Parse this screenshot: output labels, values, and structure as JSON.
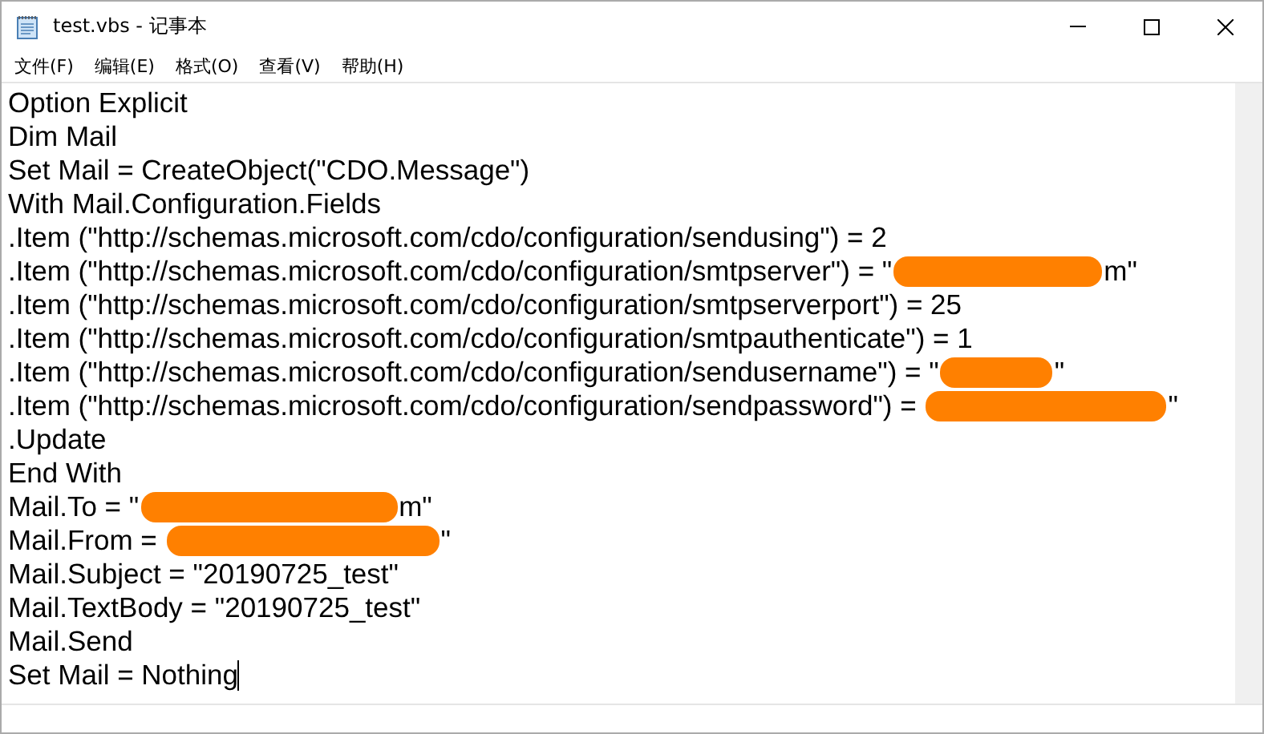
{
  "window": {
    "title": "test.vbs - 记事本"
  },
  "menu": [
    "文件(F)",
    "编辑(E)",
    "格式(O)",
    "查看(V)",
    "帮助(H)"
  ],
  "editor": {
    "lines": [
      {
        "caret": false,
        "parts": [
          {
            "kind": "text",
            "text": "Option Explicit"
          }
        ]
      },
      {
        "caret": false,
        "parts": [
          {
            "kind": "text",
            "text": "Dim Mail"
          }
        ]
      },
      {
        "caret": false,
        "parts": [
          {
            "kind": "text",
            "text": "Set Mail = CreateObject(\"CDO.Message\")"
          }
        ]
      },
      {
        "caret": false,
        "parts": [
          {
            "kind": "text",
            "text": "With Mail.Configuration.Fields"
          }
        ]
      },
      {
        "caret": false,
        "parts": [
          {
            "kind": "text",
            "text": ".Item (\"http://schemas.microsoft.com/cdo/configuration/sendusing\") = 2"
          }
        ]
      },
      {
        "caret": false,
        "parts": [
          {
            "kind": "text",
            "text": ".Item (\"http://schemas.microsoft.com/cdo/configuration/smtpserver\") = \""
          },
          {
            "kind": "redaction"
          },
          {
            "kind": "text",
            "text": "m\""
          }
        ]
      },
      {
        "caret": false,
        "parts": [
          {
            "kind": "text",
            "text": ".Item (\"http://schemas.microsoft.com/cdo/configuration/smtpserverport\") = 25"
          }
        ]
      },
      {
        "caret": false,
        "parts": [
          {
            "kind": "text",
            "text": ".Item (\"http://schemas.microsoft.com/cdo/configuration/smtpauthenticate\") = 1"
          }
        ]
      },
      {
        "caret": false,
        "parts": [
          {
            "kind": "text",
            "text": ".Item (\"http://schemas.microsoft.com/cdo/configuration/sendusername\") = \""
          },
          {
            "kind": "redaction"
          },
          {
            "kind": "text",
            "text": "\""
          }
        ]
      },
      {
        "caret": false,
        "parts": [
          {
            "kind": "text",
            "text": ".Item (\"http://schemas.microsoft.com/cdo/configuration/sendpassword\") = "
          },
          {
            "kind": "redaction"
          },
          {
            "kind": "text",
            "text": "\""
          }
        ]
      },
      {
        "caret": false,
        "parts": [
          {
            "kind": "text",
            "text": ".Update"
          }
        ]
      },
      {
        "caret": false,
        "parts": [
          {
            "kind": "text",
            "text": "End With"
          }
        ]
      },
      {
        "caret": false,
        "parts": [
          {
            "kind": "text",
            "text": "Mail.To = \""
          },
          {
            "kind": "redaction"
          },
          {
            "kind": "text",
            "text": "m\""
          }
        ]
      },
      {
        "caret": false,
        "parts": [
          {
            "kind": "text",
            "text": "Mail.From = "
          },
          {
            "kind": "redaction"
          },
          {
            "kind": "text",
            "text": "\""
          }
        ]
      },
      {
        "caret": false,
        "parts": [
          {
            "kind": "text",
            "text": "Mail.Subject = \"20190725_test\""
          }
        ]
      },
      {
        "caret": false,
        "parts": [
          {
            "kind": "text",
            "text": "Mail.TextBody = \"20190725_test\""
          }
        ]
      },
      {
        "caret": false,
        "parts": [
          {
            "kind": "text",
            "text": "Mail.Send"
          }
        ]
      },
      {
        "caret": true,
        "parts": [
          {
            "kind": "text",
            "text": "Set Mail = Nothing"
          }
        ]
      }
    ]
  }
}
